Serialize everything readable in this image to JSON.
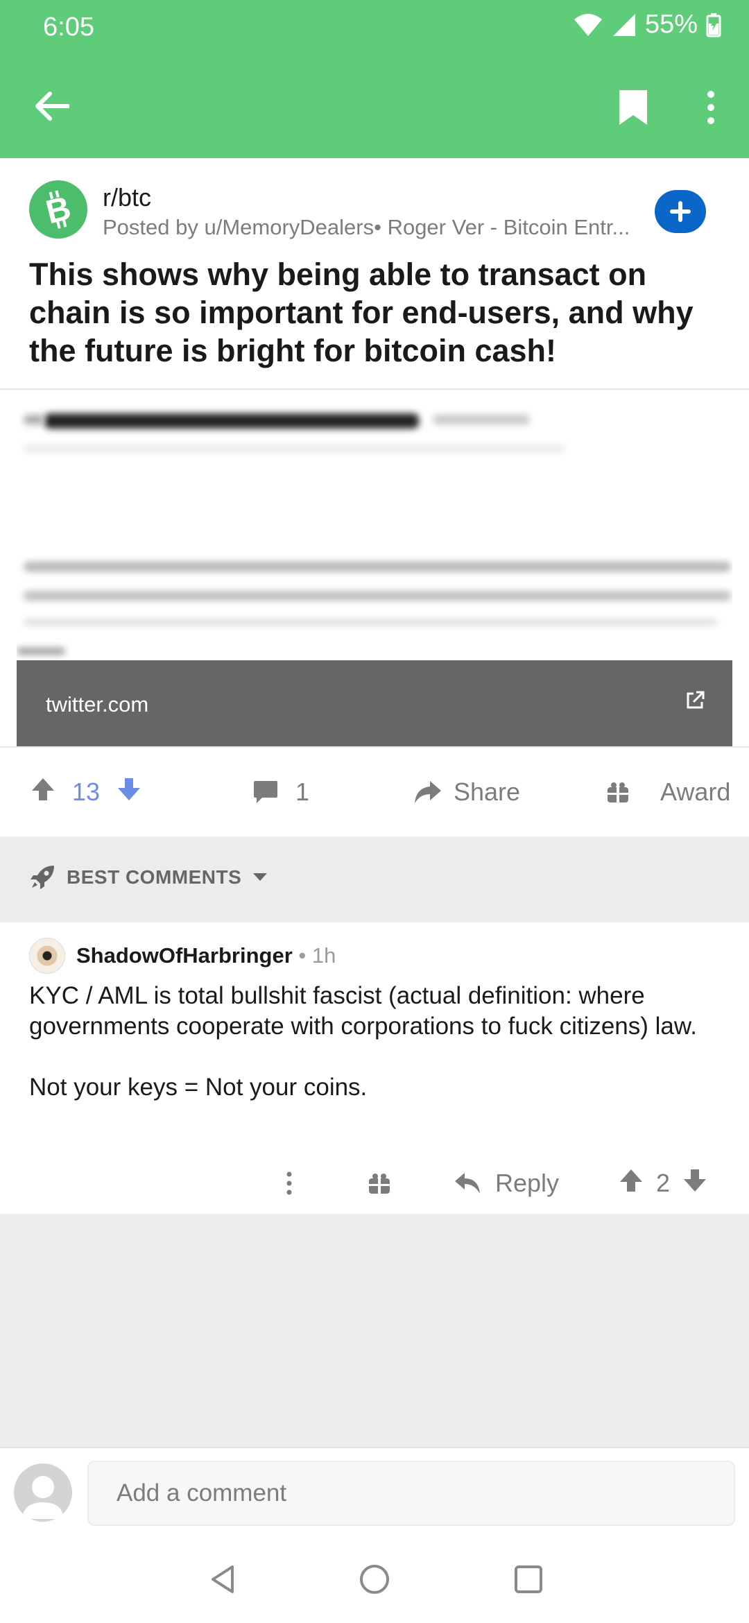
{
  "status_bar": {
    "time": "6:05",
    "battery": "55%",
    "icons": [
      "wifi-icon",
      "cell-signal-icon",
      "battery-charging-icon"
    ]
  },
  "app_bar": {
    "icons": [
      "back-arrow-icon",
      "bookmark-icon",
      "more-vert-icon"
    ]
  },
  "post": {
    "subreddit": "r/btc",
    "posted_by": "Posted by u/MemoryDealers• Roger Ver - Bitcoin Entr...",
    "title": "This shows why being able to transact on chain is so important for end-users, and why the future is bright for bitcoin cash!",
    "link_domain": "twitter.com",
    "score": "13",
    "comments": "1",
    "share_label": "Share",
    "award_label": "Award"
  },
  "sort": {
    "label": "BEST COMMENTS"
  },
  "comment": {
    "author": "ShadowOfHarbringer",
    "time": " • 1h",
    "body": "KYC / AML is total bullshit fascist (actual definition: where governments cooperate with corporations to fuck citizens) law.\n\nNot your keys = Not your coins.",
    "reply_label": "Reply",
    "score": "2"
  },
  "composer": {
    "placeholder": "Add a comment"
  },
  "colors": {
    "app_bar": "#5fcc7a",
    "upvoted": "#6a8ee6",
    "join_button": "#0a66c8",
    "subreddit_icon": "#4cbd6b"
  }
}
